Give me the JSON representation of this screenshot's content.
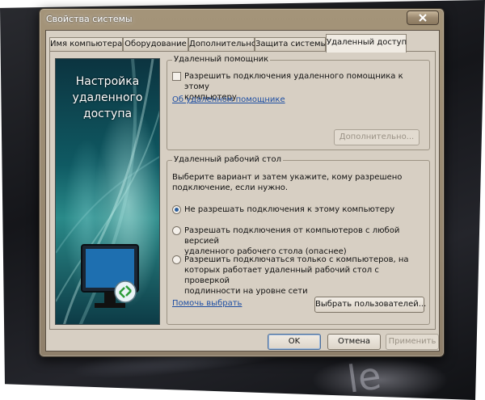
{
  "window": {
    "title": "Свойства системы"
  },
  "tabs": [
    {
      "label": "Имя компьютера",
      "active": false
    },
    {
      "label": "Оборудование",
      "active": false
    },
    {
      "label": "Дополнительно",
      "active": false
    },
    {
      "label": "Защита системы",
      "active": false
    },
    {
      "label": "Удаленный доступ",
      "active": true
    }
  ],
  "side_image": {
    "title_line1": "Настройка",
    "title_line2": "удаленного",
    "title_line3": "доступа",
    "icon": "remote-desktop-monitor-icon"
  },
  "remote_assistance": {
    "legend": "Удаленный помощник",
    "checkbox_label_line1": "Разрешить подключения удаленного помощника к этому",
    "checkbox_label_line2": "компьютеру",
    "checkbox_checked": false,
    "link": "Об удаленном помощнике",
    "advanced_button": "Дополнительно...",
    "advanced_button_enabled": false
  },
  "remote_desktop": {
    "legend": "Удаленный рабочий стол",
    "intro_line1": "Выберите вариант и затем укажите, кому разрешено",
    "intro_line2": "подключение, если нужно.",
    "options": [
      {
        "line1": "Не разрешать подключения к этому компьютеру",
        "line2": "",
        "line3": "",
        "selected": true
      },
      {
        "line1": "Разрешать подключения от компьютеров с любой версией",
        "line2": "удаленного рабочего стола (опаснее)",
        "line3": "",
        "selected": false
      },
      {
        "line1": "Разрешить подключаться только с компьютеров, на",
        "line2": "которых работает удаленный рабочий стол с проверкой",
        "line3": "подлинности на уровне сети",
        "selected": false
      }
    ],
    "help_link": "Помочь выбрать",
    "select_users_button": "Выбрать пользователей..."
  },
  "footer": {
    "ok": "OK",
    "cancel": "Отмена",
    "apply": "Применить",
    "apply_enabled": false
  },
  "backdrop_text": "le"
}
